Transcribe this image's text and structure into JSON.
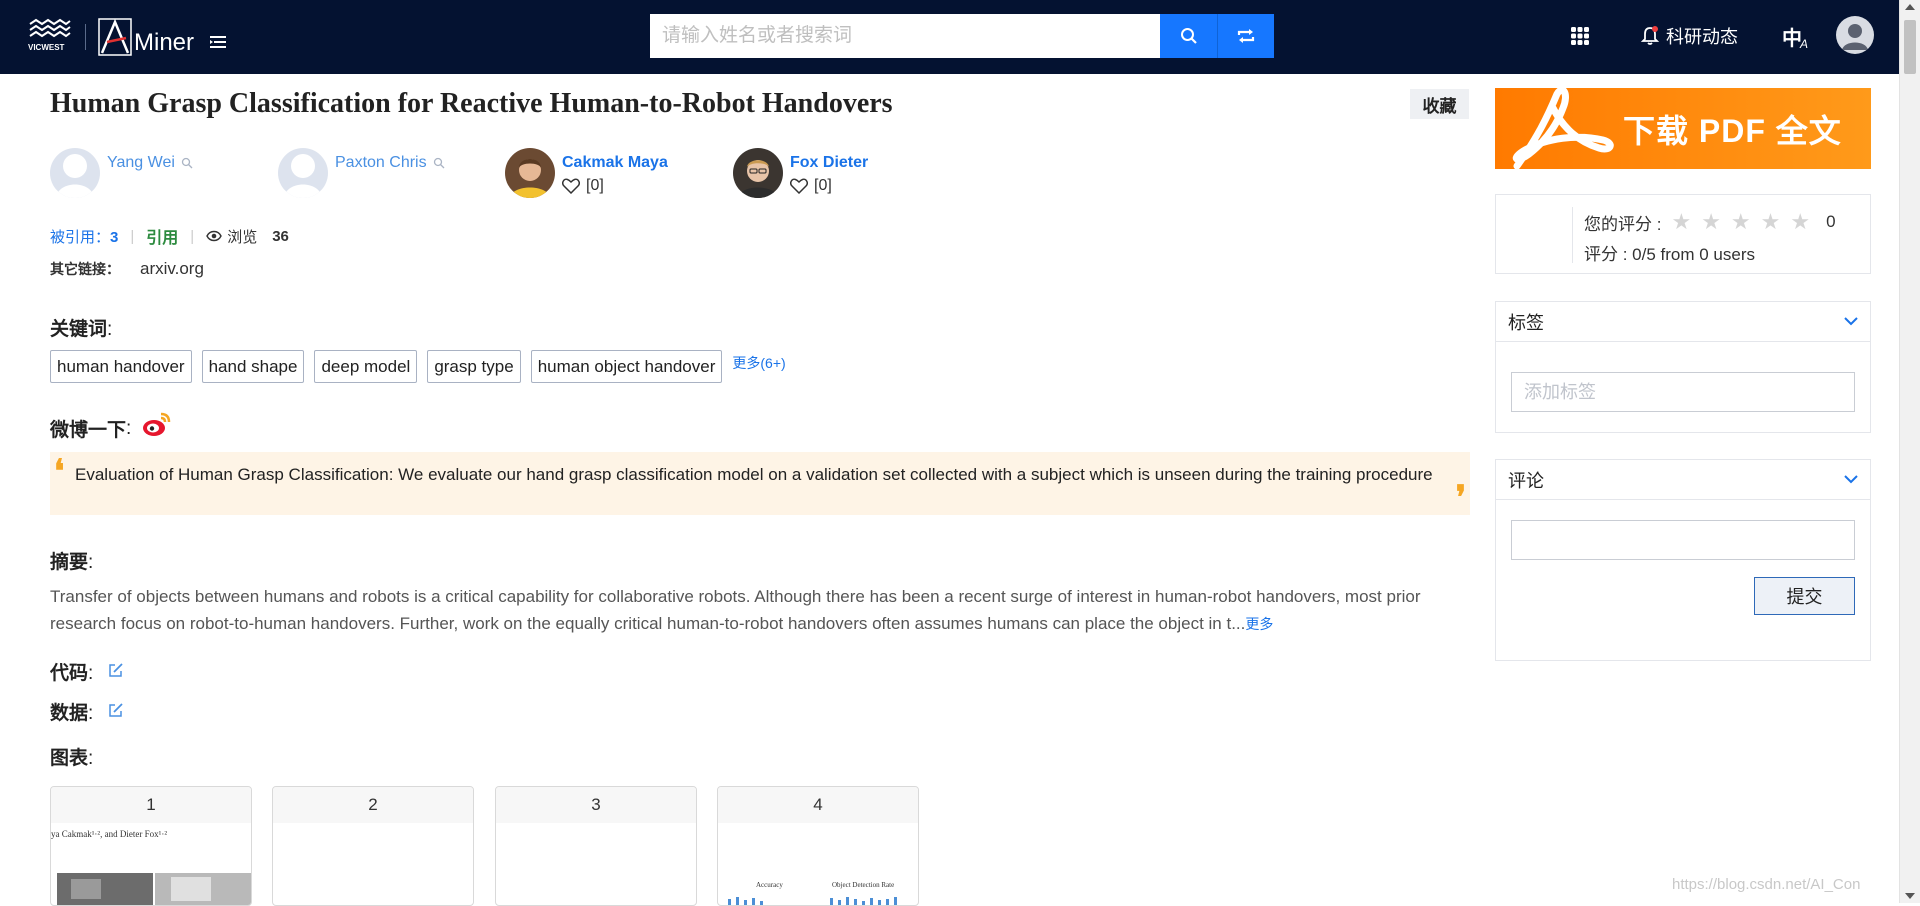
{
  "header": {
    "logo_text": "VICWEST",
    "aminer_text": "Miner",
    "search": {
      "placeholder": "请输入姓名或者搜索词",
      "value": ""
    },
    "notify_label": "科研动态",
    "lang_label": "中",
    "lang_sub": "A"
  },
  "paper": {
    "title": "Human Grasp Classification for Reactive Human-to-Robot Handovers",
    "favorite_label": "收藏",
    "authors": [
      {
        "name": "Yang Wei",
        "has_photo": false,
        "likes": ""
      },
      {
        "name": "Paxton Chris",
        "has_photo": false,
        "likes": ""
      },
      {
        "name": "Cakmak Maya",
        "has_photo": true,
        "likes": "[0]"
      },
      {
        "name": "Fox Dieter",
        "has_photo": true,
        "likes": "[0]"
      }
    ],
    "stats": {
      "cited_label": "被引用：",
      "cited_count": "3",
      "cite_label": "引用",
      "views_label": "浏览",
      "views_count": "36"
    },
    "other_links_label": "其它链接：",
    "other_link": "arxiv.org",
    "keywords_title": "关键词",
    "keywords": [
      "human handover",
      "hand shape",
      "deep model",
      "grasp type",
      "human object handover"
    ],
    "keywords_more": "更多(6+)",
    "weibo_title": "微博一下",
    "quote_text": "Evaluation of Human Grasp Classification: We evaluate our hand grasp classification model on a validation set collected with a subject which is unseen during the training procedure",
    "abstract_title": "摘要",
    "abstract_text": "Transfer of objects between humans and robots is a critical capability for collaborative robots. Although there has been a recent surge of interest in human-robot handovers, most prior research focus on robot-to-human handovers. Further, work on the equally critical human-to-robot handovers often assumes humans can place the object in t...",
    "abstract_more": "更多",
    "code_title": "代码",
    "data_title": "数据",
    "figures_title": "图表",
    "figures": [
      "1",
      "2",
      "3",
      "4"
    ],
    "fig1_caption": "ya Cakmak¹·², and Dieter Fox¹·²",
    "fig4_labels": {
      "left": "Accuracy",
      "right": "Object Detection Rate"
    }
  },
  "sidebar": {
    "pdf_label": "下载 PDF 全文",
    "rating": {
      "your_rating_label": "您的评分 :",
      "your_rating_value": "0",
      "overall": "评分 : 0/5 from 0 users"
    },
    "tags": {
      "title": "标签",
      "placeholder": "添加标签"
    },
    "comments": {
      "title": "评论",
      "submit_label": "提交"
    }
  },
  "watermark": "https://blog.csdn.net/AI_Con",
  "colors": {
    "topbar": "#041231",
    "accent": "#1677ff",
    "pdf": "#ff8a00",
    "quote_bg": "#fef4e6"
  }
}
